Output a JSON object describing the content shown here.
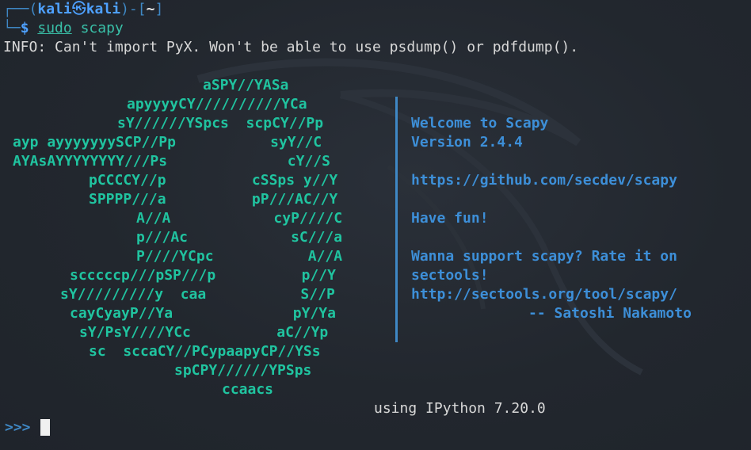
{
  "prompt": {
    "frame_open": "┌──(",
    "user": "kali",
    "skull": "㉿",
    "host": "kali",
    "mid": ")-[",
    "cwd": "~",
    "frame_close": "]",
    "corner": "└─",
    "dollar": "$",
    "sudo": "sudo",
    "command": "scapy"
  },
  "info_line": "INFO: Can't import PyX. Won't be able to use psdump() or pdfdump().",
  "ascii_art": [
    {
      "text": "aSPY//YASa"
    },
    {
      "text": "apyyyyCY//////////YCa"
    },
    {
      "text": "sY//////YSpcs  scpCY//Pp"
    },
    {
      "text": "ayp ayyyyyyySCP//Pp           syY//C"
    },
    {
      "text": "AYAsAYYYYYYYY///Ps              cY//S"
    },
    {
      "text": "pCCCCY//p          cSSps y//Y"
    },
    {
      "text": "SPPPP///a          pP///AC//Y"
    },
    {
      "text": "A//A            cyP////C"
    },
    {
      "text": "p///Ac            sC///a"
    },
    {
      "text": "P////YCpc           A//A"
    },
    {
      "text": "scccccp///pSP///p          p//Y"
    },
    {
      "text": "sY/////////y  caa           S//P"
    },
    {
      "text": "cayCyayP//Ya              pY/Ya"
    },
    {
      "text": "sY/PsY////YCc          aC//Yp"
    },
    {
      "text": "sc  sccaCY//PCypaapyCP//YSs"
    },
    {
      "text": "spCPY//////YPSps"
    },
    {
      "text": "ccaacs"
    }
  ],
  "welcome": {
    "line1": "Welcome to Scapy",
    "line2": "Version 2.4.4",
    "line3": "https://github.com/secdev/scapy",
    "line4": "Have fun!",
    "line5": "Wanna support scapy? Rate it on",
    "line6": "sectools!",
    "line7": "http://sectools.org/tool/scapy/",
    "line8": "-- Satoshi Nakamoto"
  },
  "ipython_line": "using IPython 7.20.0",
  "repl_prompt": ">>>"
}
